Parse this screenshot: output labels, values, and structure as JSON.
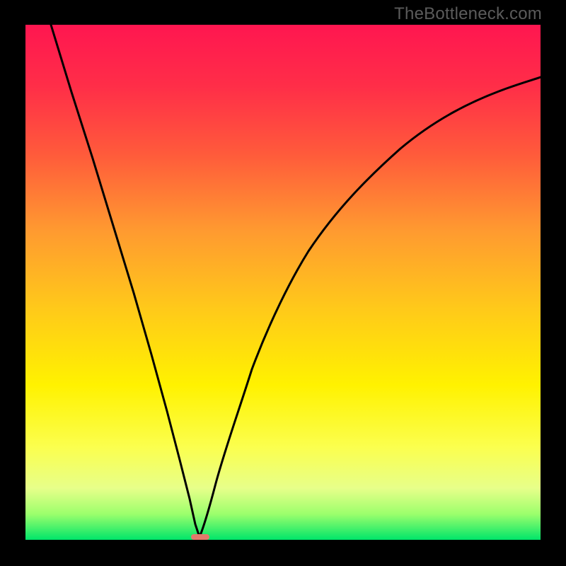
{
  "watermark": "TheBottleneck.com",
  "chart_data": {
    "type": "line",
    "title": "",
    "xlabel": "",
    "ylabel": "",
    "xlim": [
      0,
      1
    ],
    "ylim": [
      0,
      1
    ],
    "background_gradient": {
      "0.00": "#FF1650",
      "0.12": "#FF2E48",
      "0.25": "#FF5A3B",
      "0.40": "#FF9A30",
      "0.55": "#FFC91A",
      "0.70": "#FFF200",
      "0.82": "#FBFF4E",
      "0.90": "#E7FF8A",
      "0.95": "#9CFF6C",
      "1.00": "#00E56A"
    },
    "series": [
      {
        "name": "curve-left",
        "description": "steep descending branch from top-left into the cusp",
        "points": [
          {
            "x": 0.05,
            "y": 1.0
          },
          {
            "x": 0.09,
            "y": 0.87
          },
          {
            "x": 0.13,
            "y": 0.74
          },
          {
            "x": 0.17,
            "y": 0.61
          },
          {
            "x": 0.21,
            "y": 0.48
          },
          {
            "x": 0.245,
            "y": 0.36
          },
          {
            "x": 0.275,
            "y": 0.25
          },
          {
            "x": 0.3,
            "y": 0.155
          },
          {
            "x": 0.318,
            "y": 0.08
          },
          {
            "x": 0.33,
            "y": 0.03
          },
          {
            "x": 0.338,
            "y": 0.006
          }
        ]
      },
      {
        "name": "curve-right",
        "description": "ascending branch from the cusp toward upper-right, decelerating",
        "points": [
          {
            "x": 0.338,
            "y": 0.006
          },
          {
            "x": 0.35,
            "y": 0.04
          },
          {
            "x": 0.37,
            "y": 0.11
          },
          {
            "x": 0.4,
            "y": 0.21
          },
          {
            "x": 0.44,
            "y": 0.33
          },
          {
            "x": 0.49,
            "y": 0.45
          },
          {
            "x": 0.55,
            "y": 0.56
          },
          {
            "x": 0.62,
            "y": 0.66
          },
          {
            "x": 0.7,
            "y": 0.74
          },
          {
            "x": 0.79,
            "y": 0.8
          },
          {
            "x": 0.88,
            "y": 0.84
          },
          {
            "x": 1.0,
            "y": 0.88
          }
        ]
      }
    ],
    "markers": [
      {
        "name": "cusp-marker",
        "x": 0.334,
        "y": 0.004,
        "color": "#E27A6B",
        "shape": "rounded-rect"
      }
    ]
  }
}
